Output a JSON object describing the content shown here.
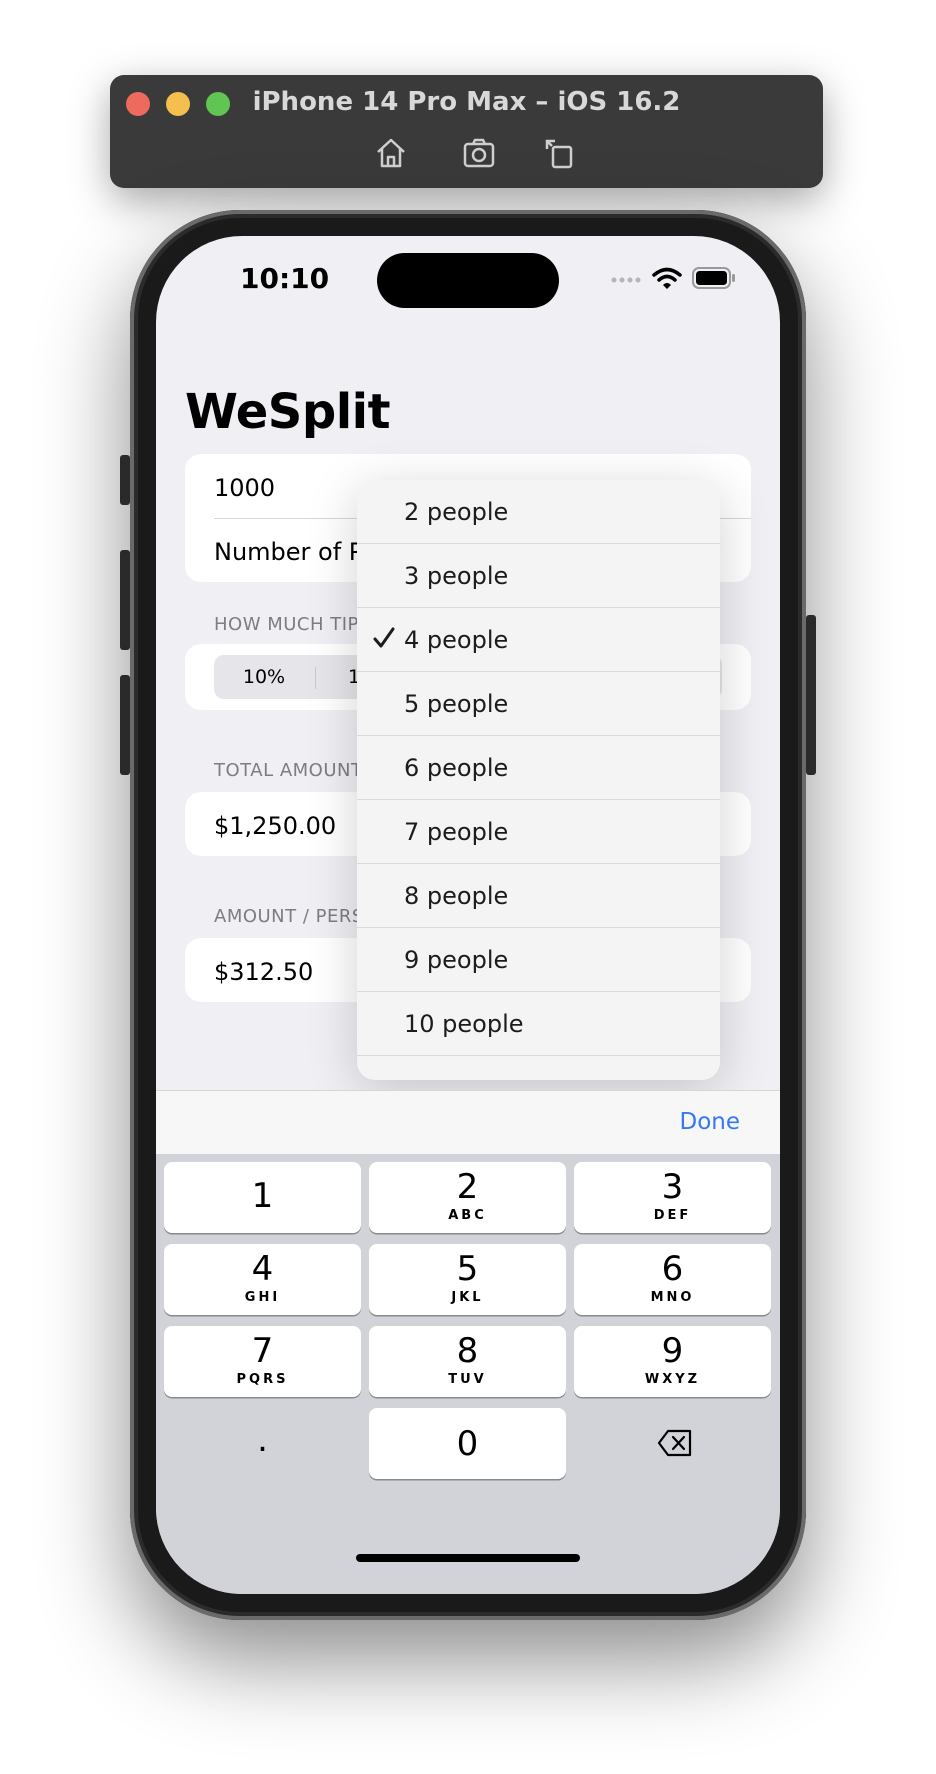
{
  "simulator": {
    "title": "iPhone 14 Pro Max – iOS 16.2",
    "tools": [
      "home-icon",
      "screenshot-icon",
      "rotate-icon"
    ]
  },
  "status_bar": {
    "time": "10:10"
  },
  "app": {
    "title": "WeSplit",
    "amount_value": "1000",
    "people_label_visible": "Number of Pe",
    "tip_header_visible": "HOW MUCH TIP",
    "tip_segments_visible": [
      "10%",
      "1"
    ],
    "total_header_visible": "TOTAL AMOUNT",
    "total_value": "$1,250.00",
    "per_person_header_visible": "AMOUNT / PERS",
    "per_person_value": "$312.50"
  },
  "people_menu": {
    "selected": "4 people",
    "items": [
      "2 people",
      "3 people",
      "4 people",
      "5 people",
      "6 people",
      "7 people",
      "8 people",
      "9 people",
      "10 people"
    ]
  },
  "keyboard": {
    "toolbar_done": "Done",
    "keys": [
      {
        "digit": "1",
        "letters": ""
      },
      {
        "digit": "2",
        "letters": "ABC"
      },
      {
        "digit": "3",
        "letters": "DEF"
      },
      {
        "digit": "4",
        "letters": "GHI"
      },
      {
        "digit": "5",
        "letters": "JKL"
      },
      {
        "digit": "6",
        "letters": "MNO"
      },
      {
        "digit": "7",
        "letters": "PQRS"
      },
      {
        "digit": "8",
        "letters": "TUV"
      },
      {
        "digit": "9",
        "letters": "WXYZ"
      }
    ],
    "decimal": ".",
    "zero": "0",
    "delete_icon": "delete-icon"
  }
}
